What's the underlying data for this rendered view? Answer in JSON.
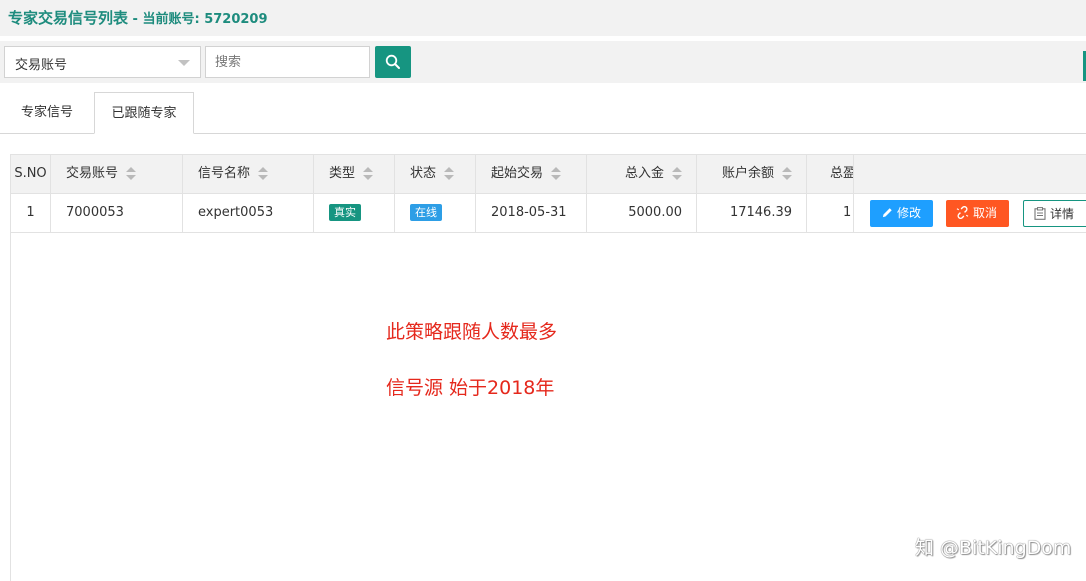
{
  "header": {
    "title": "专家交易信号列表",
    "subtitle": " - 当前账号: 5720209"
  },
  "toolbar": {
    "select_value": "交易账号",
    "search_placeholder": "搜索"
  },
  "tabs": [
    {
      "label": "专家信号",
      "active": false
    },
    {
      "label": "已跟随专家",
      "active": true
    }
  ],
  "table": {
    "columns": [
      "S.NO",
      "交易账号",
      "信号名称",
      "类型",
      "状态",
      "起始交易",
      "总入金",
      "账户余额",
      "总盈"
    ],
    "rows": [
      {
        "sno": "1",
        "account": "7000053",
        "signal_name": "expert0053",
        "type": "真实",
        "status": "在线",
        "start_trade": "2018-05-31",
        "total_deposit": "5000.00",
        "balance": "17146.39",
        "total_profit": "1"
      }
    ],
    "actions": {
      "edit": "修改",
      "cancel": "取消",
      "detail": "详情"
    }
  },
  "annotations": {
    "line1": "此策略跟随人数最多",
    "line2": "信号源 始于2018年"
  },
  "watermark": "知 @BitKingDom",
  "colors": {
    "accent": "#169581",
    "title": "#1e8c7e",
    "badge_real": "#169581",
    "badge_online": "#2d9ee6",
    "edit_button": "#1e9fff",
    "cancel_button": "#ff5722",
    "annotation": "#e5281c"
  }
}
